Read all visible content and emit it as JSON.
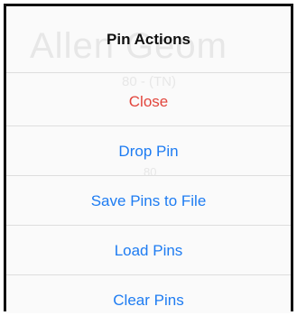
{
  "background": {
    "ghost_title": "Allen Geom",
    "ghost_line1": "80 - (TN)",
    "ghost_line2": "80"
  },
  "sheet": {
    "title": "Pin Actions",
    "actions": [
      {
        "label": "Close",
        "color": "#e2453c"
      },
      {
        "label": "Drop Pin",
        "color": "#1e7cf2"
      },
      {
        "label": "Save Pins to File",
        "color": "#1e7cf2"
      },
      {
        "label": "Load Pins",
        "color": "#1e7cf2"
      },
      {
        "label": "Clear Pins",
        "color": "#1e7cf2"
      }
    ]
  }
}
